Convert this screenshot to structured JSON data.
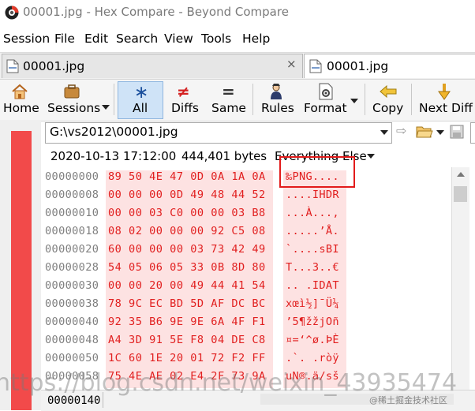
{
  "window": {
    "title": "00001.jpg - Hex Compare - Beyond Compare"
  },
  "menu": [
    "Session",
    "File",
    "Edit",
    "Search",
    "View",
    "Tools",
    "Help"
  ],
  "tabs": [
    {
      "label": "00001.jpg",
      "close": "×"
    },
    {
      "label": "00001.jpg"
    }
  ],
  "toolbar": {
    "home": "Home",
    "sessions": "Sessions",
    "all": "All",
    "diffs": "Diffs",
    "same": "Same",
    "rules": "Rules",
    "format": "Format",
    "copy": "Copy",
    "next_diff": "Next Diff"
  },
  "file": {
    "path": "G:\\vs2012\\00001.jpg",
    "date": "2020-10-13 17:12:00",
    "size": "444,401 bytes",
    "filter": "Everything Else"
  },
  "hex_rows": [
    {
      "addr": "00000000",
      "hex": "89 50 4E 47 0D 0A 1A 0A",
      "ascii": "‰PNG...."
    },
    {
      "addr": "00000008",
      "hex": "00 00 00 0D 49 48 44 52",
      "ascii": "....IHDR"
    },
    {
      "addr": "00000010",
      "hex": "00 00 03 C0 00 00 03 B8",
      "ascii": "...À...,"
    },
    {
      "addr": "00000018",
      "hex": "08 02 00 00 00 92 C5 08",
      "ascii": ".....’Å."
    },
    {
      "addr": "00000020",
      "hex": "60 00 00 00 03 73 42 49",
      "ascii": "`....sBI"
    },
    {
      "addr": "00000028",
      "hex": "54 05 06 05 33 0B 8D 80",
      "ascii": "T...3..€"
    },
    {
      "addr": "00000030",
      "hex": "00 00 20 00 49 44 41 54",
      "ascii": ".. .IDAT"
    },
    {
      "addr": "00000038",
      "hex": "78 9C EC BD 5D AF DC BC",
      "ascii": "xœì½]¯Ü¼"
    },
    {
      "addr": "00000040",
      "hex": "92 35 B6 9E 9E 6A 4F F1",
      "ascii": "’5¶žžjOñ"
    },
    {
      "addr": "00000048",
      "hex": "A4 3D 91 5E F8 04 DE C8",
      "ascii": "¤=‘^ø.ÞÈ"
    },
    {
      "addr": "00000050",
      "hex": "1C 60 1E 20 01 72 F2 FF",
      "ascii": ".`. .ròÿ"
    },
    {
      "addr": "00000058",
      "hex": "75 4E AE 02 E4 2F 73 9A",
      "ascii": "uN®.ä/sš"
    }
  ],
  "status": {
    "offset": "00000140"
  },
  "watermarks": {
    "main": "https://blog.csdn.net/weixin_43935474",
    "corner": "@稀土掘金技术社区"
  },
  "colors": {
    "diff_text": "#e11f1f",
    "diff_bg": "#fde2e2",
    "left_bar": "#f24a4a",
    "highlight": "#e21b1b",
    "selected_button": "#cfe3f7"
  },
  "icons": [
    "app-icon",
    "home-icon",
    "sessions-icon",
    "all-icon",
    "diffs-icon",
    "same-icon",
    "rules-icon",
    "format-icon",
    "copy-icon",
    "next-diff-icon",
    "refresh-icon",
    "open-folder-icon",
    "save-icon"
  ]
}
